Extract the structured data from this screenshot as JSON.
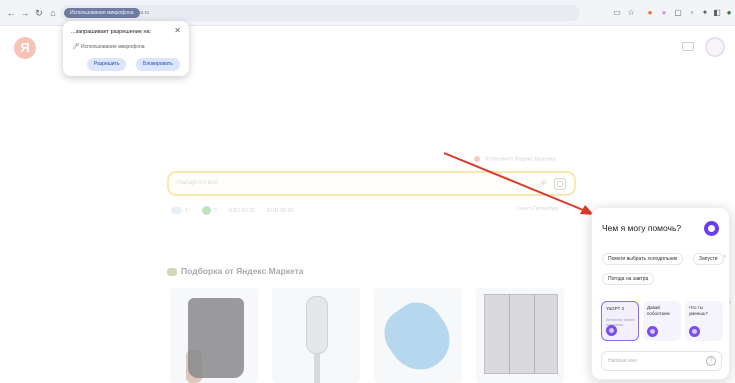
{
  "browser": {
    "site_chip": "Использование микрофона",
    "url": "ya.ru"
  },
  "permission": {
    "title": "...запрашивает разрешение на:",
    "item": "Использование микрофона",
    "allow_label": "Разрешить",
    "block_label": "Блокировать"
  },
  "page": {
    "set_default": "Установите Яндекс Браузер",
    "search_placeholder": "Найдётся всё",
    "weather": "1°",
    "traffic": "3",
    "usd": "USD 90.30",
    "eur": "EUR 98.80",
    "city": "Санкт-Петербург",
    "section_title": "Подборка от Яндекс Маркета"
  },
  "assistant": {
    "title": "Чем я могу помочь?",
    "chips": [
      "Помоги выбрать холодильник",
      "Запусти",
      "Погода на завтра"
    ],
    "cards": [
      {
        "title": "YaGPT 2",
        "sub": "Интеллект нового поколения"
      },
      {
        "title": "Давай поболтаем",
        "sub": ""
      },
      {
        "title": "Что ты умеешь?",
        "sub": ""
      }
    ],
    "input_placeholder": "Напиши мне"
  },
  "colors": {
    "accent": "#6a3df0",
    "arrow": "#d93a2b",
    "search_border": "#f8dc86"
  }
}
